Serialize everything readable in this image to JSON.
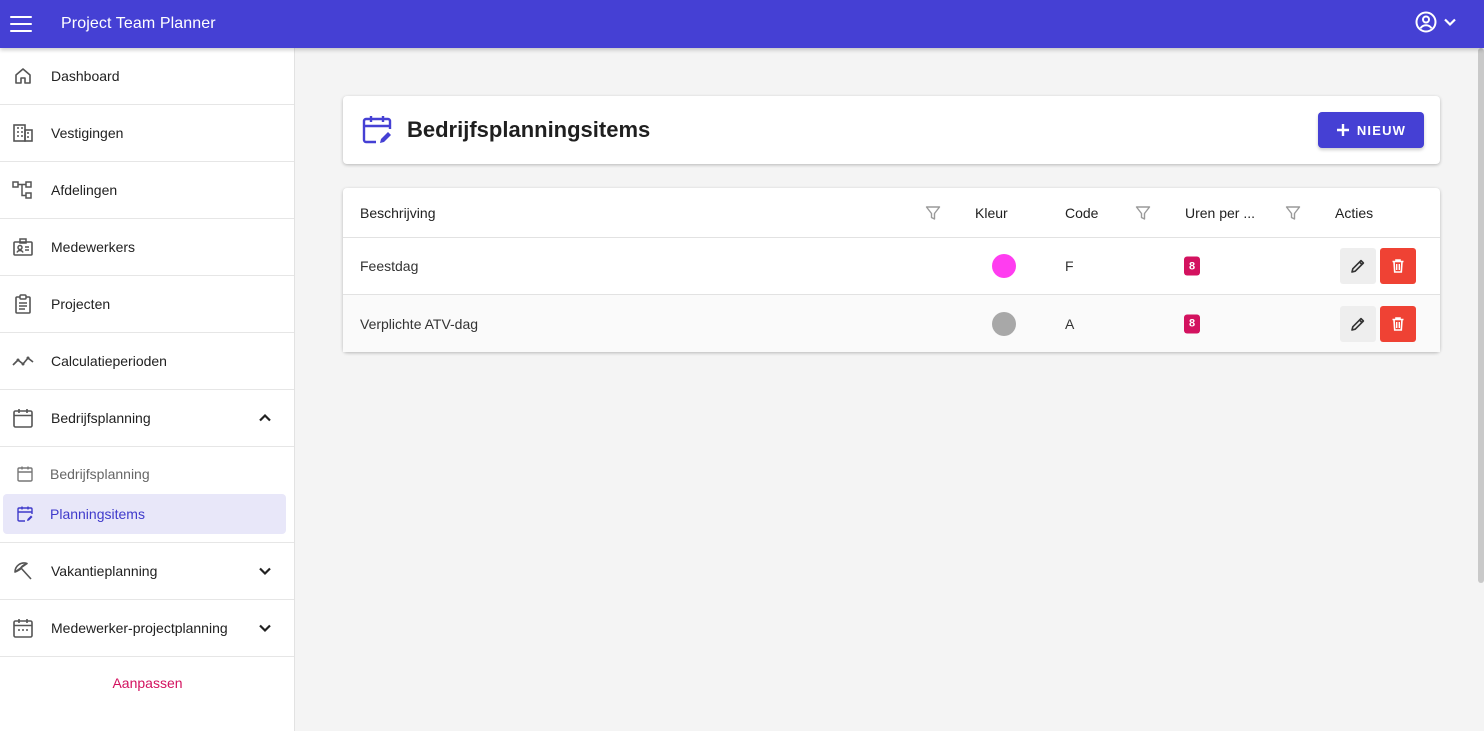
{
  "app": {
    "title": "Project Team Planner"
  },
  "sidebar": {
    "items": [
      {
        "label": "Dashboard",
        "icon": "home-icon"
      },
      {
        "label": "Vestigingen",
        "icon": "building-icon"
      },
      {
        "label": "Afdelingen",
        "icon": "org-chart-icon"
      },
      {
        "label": "Medewerkers",
        "icon": "id-badge-icon"
      },
      {
        "label": "Projecten",
        "icon": "clipboard-icon"
      },
      {
        "label": "Calculatieperioden",
        "icon": "trend-line-icon"
      },
      {
        "label": "Bedrijfsplanning",
        "icon": "calendar-icon",
        "expanded": true
      }
    ],
    "sub_items": [
      {
        "label": "Bedrijfsplanning",
        "icon": "calendar-icon",
        "active": false
      },
      {
        "label": "Planningsitems",
        "icon": "calendar-edit-icon",
        "active": true
      }
    ],
    "items_after": [
      {
        "label": "Vakantieplanning",
        "icon": "beach-umbrella-icon",
        "expanded": false
      },
      {
        "label": "Medewerker-projectplanning",
        "icon": "calendar-dots-icon",
        "expanded": false
      }
    ],
    "customize_label": "Aanpassen"
  },
  "page": {
    "title": "Bedrijfsplanningsitems",
    "new_button_label": "NIEUW"
  },
  "table": {
    "columns": [
      "Beschrijving",
      "Kleur",
      "Code",
      "Uren per ...",
      "Acties"
    ],
    "rows": [
      {
        "description": "Feestdag",
        "color": "#ff3df0",
        "code": "F",
        "hours": "8"
      },
      {
        "description": "Verplichte ATV-dag",
        "color": "#a8a8a8",
        "code": "A",
        "hours": "8"
      }
    ]
  },
  "colors": {
    "primary": "#4540d4",
    "accent": "#d3125f",
    "danger": "#ef4234"
  }
}
